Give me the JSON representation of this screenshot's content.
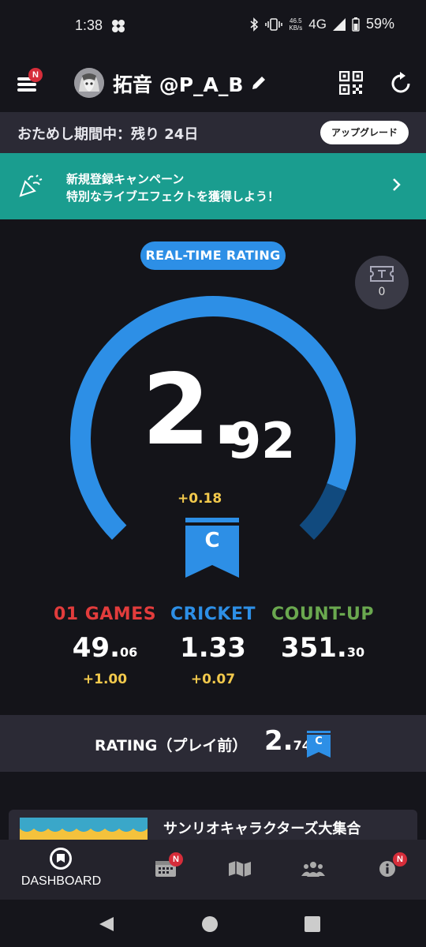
{
  "status_bar": {
    "time": "1:38",
    "net_speed_value": "46.5",
    "net_speed_unit": "KB/s",
    "network": "4G",
    "battery": "59%"
  },
  "header": {
    "username": "拓音 @P_A_B",
    "menu_badge": "N"
  },
  "trial": {
    "text": "おためし期間中：残り 24日",
    "upgrade_label": "アップグレード"
  },
  "campaign": {
    "line1": "新規登録キャンペーン",
    "line2": "特別なライブエフェクトを獲得しよう！"
  },
  "rating": {
    "title": "REAL-TIME RATING",
    "ticket_count": "0",
    "integer": "2.",
    "decimal": "92",
    "delta": "+0.18",
    "class": "C",
    "gauge_fraction": 0.292,
    "colors": {
      "accent": "#2d8fe6",
      "dark_segment": "#114a7e",
      "delta": "#f2c94c"
    }
  },
  "stats": [
    {
      "label": "01 GAMES",
      "color": "#e23c3c",
      "value_main": "49.",
      "value_small": "06",
      "delta": "+1.00"
    },
    {
      "label": "CRICKET",
      "color": "#2d8fe6",
      "value_main": "1.33",
      "value_small": "",
      "delta": "+0.07"
    },
    {
      "label": "COUNT-UP",
      "color": "#6aa84f",
      "value_main": "351.",
      "value_small": "30",
      "delta": ""
    }
  ],
  "pre_rating": {
    "label": "RATING（プレイ前）",
    "value_main": "2.",
    "value_small": "74",
    "class": "C"
  },
  "banner": {
    "title": "サンリオキャラクターズ大集合"
  },
  "bottom_nav": {
    "dashboard_label": "DASHBOARD",
    "calendar_badge": "N",
    "info_badge": "N"
  }
}
